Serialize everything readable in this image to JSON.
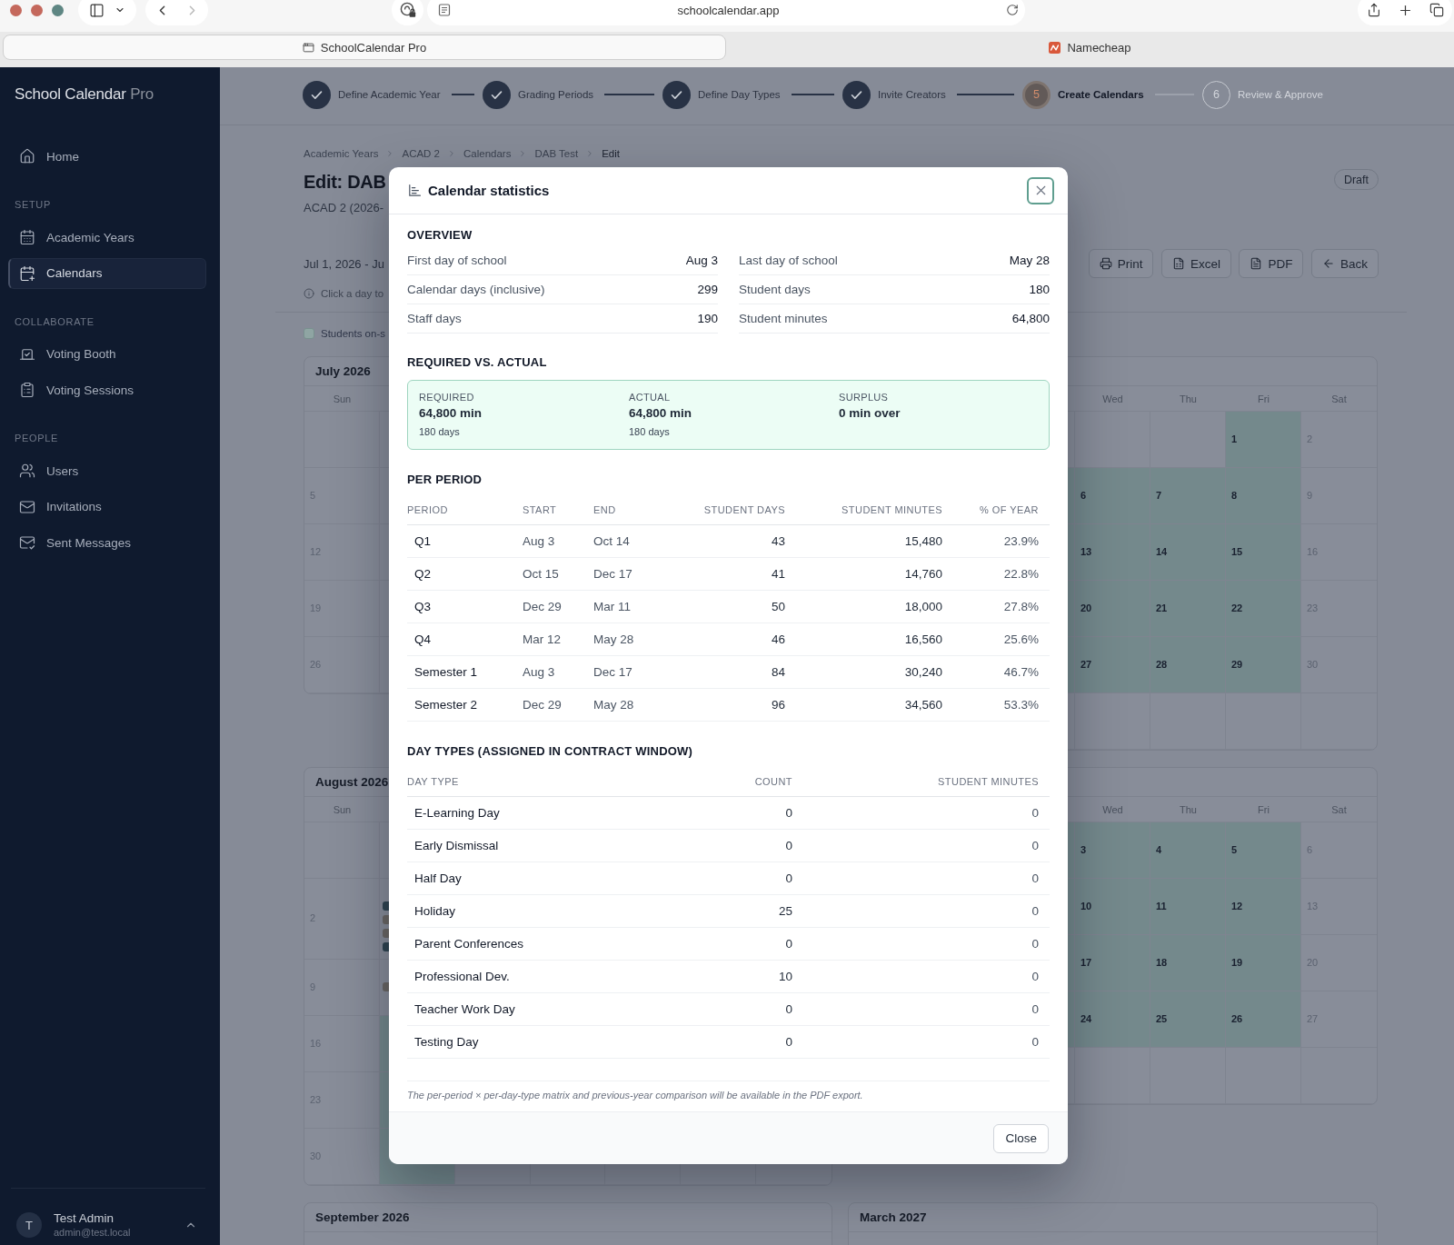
{
  "browser": {
    "url": "schoolcalendar.app",
    "tabs": [
      {
        "title": "SchoolCalendar Pro",
        "selected": true
      },
      {
        "title": "Namecheap",
        "selected": false
      }
    ]
  },
  "sidebar": {
    "brand": {
      "name": "School Calendar",
      "suffix": "Pro"
    },
    "sections": [
      {
        "items": [
          {
            "label": "Home",
            "selected": false
          }
        ]
      },
      {
        "heading": "SETUP",
        "items": [
          {
            "label": "Academic Years",
            "selected": false
          },
          {
            "label": "Calendars",
            "selected": true
          }
        ]
      },
      {
        "heading": "COLLABORATE",
        "items": [
          {
            "label": "Voting Booth",
            "selected": false
          },
          {
            "label": "Voting Sessions",
            "selected": false
          }
        ]
      },
      {
        "heading": "PEOPLE",
        "items": [
          {
            "label": "Users",
            "selected": false
          },
          {
            "label": "Invitations",
            "selected": false
          },
          {
            "label": "Sent Messages",
            "selected": false
          }
        ]
      }
    ],
    "user": {
      "initial": "T",
      "name": "Test Admin",
      "email": "admin@test.local"
    }
  },
  "stepper": {
    "steps": [
      {
        "label": "Define Academic Year",
        "completed": true,
        "current": false
      },
      {
        "label": "Grading Periods",
        "completed": true,
        "current": false
      },
      {
        "label": "Define Day Types",
        "completed": true,
        "current": false
      },
      {
        "label": "Invite Creators",
        "completed": true,
        "current": false
      },
      {
        "number": "5",
        "label": "Create Calendars",
        "completed": false,
        "current": true
      },
      {
        "number": "6",
        "label": "Review & Approve",
        "completed": false,
        "current": false
      }
    ]
  },
  "page": {
    "breadcrumb": [
      "Academic Years",
      "ACAD 2",
      "Calendars",
      "DAB Test",
      "Edit"
    ],
    "title": "Edit: DAB",
    "status_badge": "Draft",
    "subtitle": "ACAD 2 (2026-",
    "date_range": "Jul 1, 2026 - Ju",
    "actions": [
      "Print",
      "Excel",
      "PDF",
      "Back"
    ],
    "hint": "Click a day to",
    "legend": [
      "Students on-s"
    ]
  },
  "calendars": [
    {
      "title": "July 2026",
      "right_side_covered": true,
      "weekdays": [
        "Sun"
      ],
      "weeks": [
        [
          {
            "student_day": false
          },
          {
            "student_day": false
          }
        ],
        [
          {
            "day": "5",
            "student_day": false
          },
          {
            "student_day": false
          }
        ],
        [
          {
            "day": "12",
            "student_day": false
          },
          {
            "student_day": false
          }
        ],
        [
          {
            "day": "19",
            "student_day": false
          },
          {
            "student_day": false
          }
        ],
        [
          {
            "day": "26",
            "student_day": false
          },
          {
            "student_day": false
          }
        ]
      ]
    },
    {
      "right_side_covered": false,
      "weekdays": [
        "Wed",
        "Thu",
        "Fri",
        "Sat"
      ],
      "weeks": [
        [
          {
            "student_day": false
          },
          {
            "student_day": false
          },
          {
            "student_day": false
          },
          {
            "day": "1",
            "student_day": true
          },
          {
            "day": "2",
            "student_day": false
          }
        ],
        [
          {
            "student_day": true
          },
          {
            "day": "6",
            "student_day": true
          },
          {
            "day": "7",
            "student_day": true
          },
          {
            "day": "8",
            "student_day": true
          },
          {
            "day": "9",
            "student_day": false
          }
        ],
        [
          {
            "student_day": true
          },
          {
            "day": "13",
            "student_day": true
          },
          {
            "day": "14",
            "student_day": true
          },
          {
            "day": "15",
            "student_day": true
          },
          {
            "day": "16",
            "student_day": false
          }
        ],
        [
          {
            "student_day": true
          },
          {
            "day": "20",
            "student_day": true
          },
          {
            "day": "21",
            "student_day": true
          },
          {
            "day": "22",
            "student_day": true
          },
          {
            "day": "23",
            "student_day": false
          }
        ],
        [
          {
            "student_day": true
          },
          {
            "day": "27",
            "student_day": true
          },
          {
            "day": "28",
            "student_day": true
          },
          {
            "day": "29",
            "student_day": true
          },
          {
            "day": "30",
            "student_day": false
          }
        ],
        [
          {
            "student_day": false
          },
          {
            "student_day": false
          },
          {
            "student_day": false
          },
          {
            "student_day": false
          },
          {
            "student_day": false
          }
        ]
      ]
    },
    {
      "title": "August 2026",
      "right_side_covered": true,
      "weekdays": [
        "Sun"
      ],
      "weeks": [
        [
          {
            "student_day": false
          },
          {
            "student_day": false
          }
        ],
        [
          {
            "day": "2",
            "student_day": false
          },
          {
            "student_day": false,
            "events": [
              {
                "color": "#2f4450"
              },
              {
                "color": "#6b6764"
              },
              {
                "color": "#6b6764"
              },
              {
                "color": "#2f4450"
              }
            ]
          }
        ],
        [
          {
            "day": "9",
            "student_day": false
          },
          {
            "student_day": false,
            "events": [
              {
                "color": "#6b6764"
              }
            ]
          }
        ],
        [
          {
            "day": "16",
            "student_day": false
          },
          {
            "student_day": true
          }
        ],
        [
          {
            "day": "23",
            "student_day": false
          },
          {
            "student_day": true
          }
        ],
        [
          {
            "day": "30",
            "student_day": false
          },
          {
            "student_day": true
          },
          {
            "student_day": false
          },
          {
            "student_day": false
          },
          {
            "student_day": false
          },
          {
            "student_day": false
          },
          {
            "student_day": false
          }
        ]
      ]
    },
    {
      "right_side_covered": false,
      "weekdays": [
        "Wed",
        "Thu",
        "Fri",
        "Sat"
      ],
      "weeks": [
        [
          {
            "student_day": true
          },
          {
            "day": "3",
            "student_day": true
          },
          {
            "day": "4",
            "student_day": true
          },
          {
            "day": "5",
            "student_day": true
          },
          {
            "day": "6",
            "student_day": false
          }
        ],
        [
          {
            "student_day": true
          },
          {
            "day": "10",
            "student_day": true
          },
          {
            "day": "11",
            "student_day": true
          },
          {
            "day": "12",
            "student_day": true
          },
          {
            "day": "13",
            "student_day": false
          }
        ],
        [
          {
            "student_day": true
          },
          {
            "day": "17",
            "student_day": true
          },
          {
            "day": "18",
            "student_day": true
          },
          {
            "day": "19",
            "student_day": true
          },
          {
            "day": "20",
            "student_day": false
          }
        ],
        [
          {
            "student_day": true
          },
          {
            "day": "24",
            "student_day": true
          },
          {
            "day": "25",
            "student_day": true
          },
          {
            "day": "26",
            "student_day": true
          },
          {
            "day": "27",
            "student_day": false
          }
        ],
        [
          {
            "student_day": false
          },
          {
            "student_day": false
          },
          {
            "student_day": false
          },
          {
            "student_day": false
          },
          {
            "student_day": false
          }
        ]
      ]
    },
    {
      "title": "September 2026"
    },
    {
      "title": "March 2027"
    }
  ],
  "statistics": {
    "title": "Calendar statistics",
    "overview": {
      "heading": "OVERVIEW",
      "stats": [
        {
          "label": "First day of school",
          "value": "Aug 3"
        },
        {
          "label": "Last day of school",
          "value": "May 28"
        },
        {
          "label": "Calendar days (inclusive)",
          "value": "299"
        },
        {
          "label": "Student days",
          "value": "180"
        },
        {
          "label": "Staff days",
          "value": "190"
        },
        {
          "label": "Student minutes",
          "value": "64,800"
        }
      ]
    },
    "required_vs_actual": {
      "heading": "REQUIRED VS. ACTUAL",
      "met": true,
      "items": [
        {
          "label": "REQUIRED",
          "value": "64,800 min",
          "detail": "180 days"
        },
        {
          "label": "ACTUAL",
          "value": "64,800 min",
          "detail": "180 days"
        },
        {
          "label": "SURPLUS",
          "value": "0 min over"
        }
      ]
    },
    "per_period": {
      "heading": "PER PERIOD",
      "columns": [
        "PERIOD",
        "START",
        "END",
        "STUDENT DAYS",
        "STUDENT MINUTES",
        "% OF YEAR"
      ],
      "rows": [
        [
          "Q1",
          "Aug 3",
          "Oct 14",
          "43",
          "15,480",
          "23.9%"
        ],
        [
          "Q2",
          "Oct 15",
          "Dec 17",
          "41",
          "14,760",
          "22.8%"
        ],
        [
          "Q3",
          "Dec 29",
          "Mar 11",
          "50",
          "18,000",
          "27.8%"
        ],
        [
          "Q4",
          "Mar 12",
          "May 28",
          "46",
          "16,560",
          "25.6%"
        ],
        [
          "Semester 1",
          "Aug 3",
          "Dec 17",
          "84",
          "30,240",
          "46.7%"
        ],
        [
          "Semester 2",
          "Dec 29",
          "May 28",
          "96",
          "34,560",
          "53.3%"
        ]
      ]
    },
    "day_types": {
      "heading": "DAY TYPES (ASSIGNED IN CONTRACT WINDOW)",
      "columns": [
        "DAY TYPE",
        "COUNT",
        "STUDENT MINUTES"
      ],
      "rows": [
        [
          "E-Learning Day",
          "0",
          "0"
        ],
        [
          "Early Dismissal",
          "0",
          "0"
        ],
        [
          "Half Day",
          "0",
          "0"
        ],
        [
          "Holiday",
          "25",
          "0"
        ],
        [
          "Parent Conferences",
          "0",
          "0"
        ],
        [
          "Professional Dev.",
          "10",
          "0"
        ],
        [
          "Teacher Work Day",
          "0",
          "0"
        ],
        [
          "Testing Day",
          "0",
          "0"
        ]
      ]
    },
    "footnote": "The per-period × per-day-type matrix and previous-year comparison will be available in the PDF export.",
    "close_button": "Close"
  }
}
